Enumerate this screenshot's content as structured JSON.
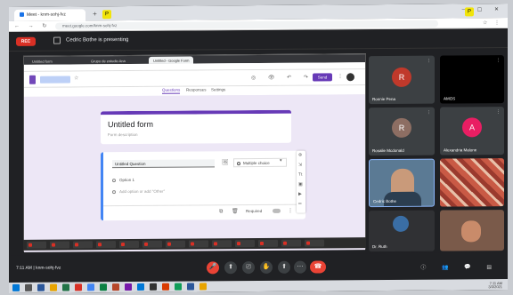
{
  "browser": {
    "tab1": "Meet - knm-sohj-fvz",
    "new_tab": "+",
    "window_controls": "– ▢ ✕",
    "marker1": "P",
    "marker2": "P",
    "url": "meet.google.com/knm-sohj-fvz",
    "nav_icons": "← → ↻",
    "toolbar_icons": "☆ ⋮"
  },
  "meet": {
    "rec_label": "REC",
    "presenting_text": "Cedric Bothe is presenting",
    "meeting_time": "7:11 AM",
    "meeting_code": "knm-sohj-fvz",
    "control_icons": [
      "⬆",
      "⎚",
      "✋",
      "⋯"
    ],
    "end_icon": "☎",
    "mic_icon": "🎤",
    "right_icons": "ⓘ 👥 💬 ▤"
  },
  "shared": {
    "inner_tabs": [
      "Untitled form",
      "Grupo de estudio Ana",
      "Untitled - Google Form"
    ],
    "forms_star": "☆",
    "forms_tools": "◎ 👁 ↶ ↷ ⚙",
    "send_label": "Send",
    "more": "⋮",
    "tabs": [
      "Questions",
      "Responses",
      "Settings"
    ],
    "form_title": "Untitled form",
    "form_desc": "Form description",
    "question_placeholder": "Untitled Question",
    "q_img_icon": "🖼",
    "question_type": "Multiple choice",
    "q_caret": "▾",
    "option1": "Option 1",
    "option_add": "Add option  or  add \"Other\"",
    "q_foot_icons": "⧉ 🗑",
    "required_label": "Required",
    "q_more": "⋮",
    "side_icons": [
      "⊕",
      "⇲",
      "Tt",
      "▣",
      "▶",
      "═"
    ]
  },
  "participants": [
    {
      "name": "Ronnie Pena",
      "initial": "R",
      "color": "#c0392b"
    },
    {
      "name": "AMOS",
      "initial": "",
      "color": "#000000"
    },
    {
      "name": "Rosalie Mcdonald",
      "initial": "R",
      "color": "#8d6e63"
    },
    {
      "name": "Alexandria Malone",
      "initial": "A",
      "color": "#e91e63"
    },
    {
      "name": "Cedric Bothe",
      "initial": "",
      "color": "#4a6b8c"
    },
    {
      "name": "",
      "initial": "",
      "color": "#b34a3c"
    },
    {
      "name": "Dr. Ruth",
      "initial": "",
      "color": "#303134"
    },
    {
      "name": "",
      "initial": "",
      "color": "#7a5a4a"
    }
  ],
  "taskbar": {
    "clock_time": "7:11 AM",
    "clock_date": "3/3/2021"
  }
}
